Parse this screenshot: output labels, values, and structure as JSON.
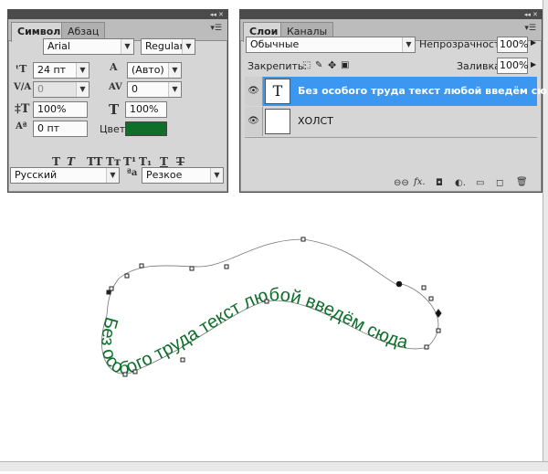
{
  "character_panel": {
    "tabs": [
      {
        "label": "Символ"
      },
      {
        "label": "Абзац"
      }
    ],
    "font_family": "Arial",
    "font_style": "Regular",
    "font_size": "24 пт",
    "leading": "(Авто)",
    "kerning": "0",
    "tracking": "0",
    "vertical_scale": "100%",
    "horizontal_scale": "100%",
    "baseline_shift": "0 пт",
    "color_label": "Цвет:",
    "color_value": "#0e6e2a",
    "style_buttons": [
      "T",
      "T",
      "TT",
      "Tт",
      "T¹",
      "T₁",
      "T",
      "T"
    ],
    "language": "Русский",
    "aa_label": "ªa",
    "antialias": "Резкое"
  },
  "layers_panel": {
    "tabs": [
      {
        "label": "Слои"
      },
      {
        "label": "Каналы"
      }
    ],
    "blend_mode": "Обычные",
    "opacity_label": "Непрозрачность:",
    "opacity_value": "100%",
    "lock_label": "Закрепить:",
    "fill_label": "Заливка:",
    "fill_value": "100%",
    "layers": [
      {
        "name": "Без особого труда текст любой введём сюда",
        "type": "text",
        "thumb": "T",
        "selected": true
      },
      {
        "name": "ХОЛСТ",
        "type": "raster",
        "thumb": "",
        "selected": false
      }
    ]
  },
  "canvas": {
    "path_text": "Без особого труда текст любой введём сюда",
    "text_color": "#0e6e2a"
  },
  "colors": {
    "panel_bg": "#d6d6d6",
    "selection": "#3b97f0"
  }
}
